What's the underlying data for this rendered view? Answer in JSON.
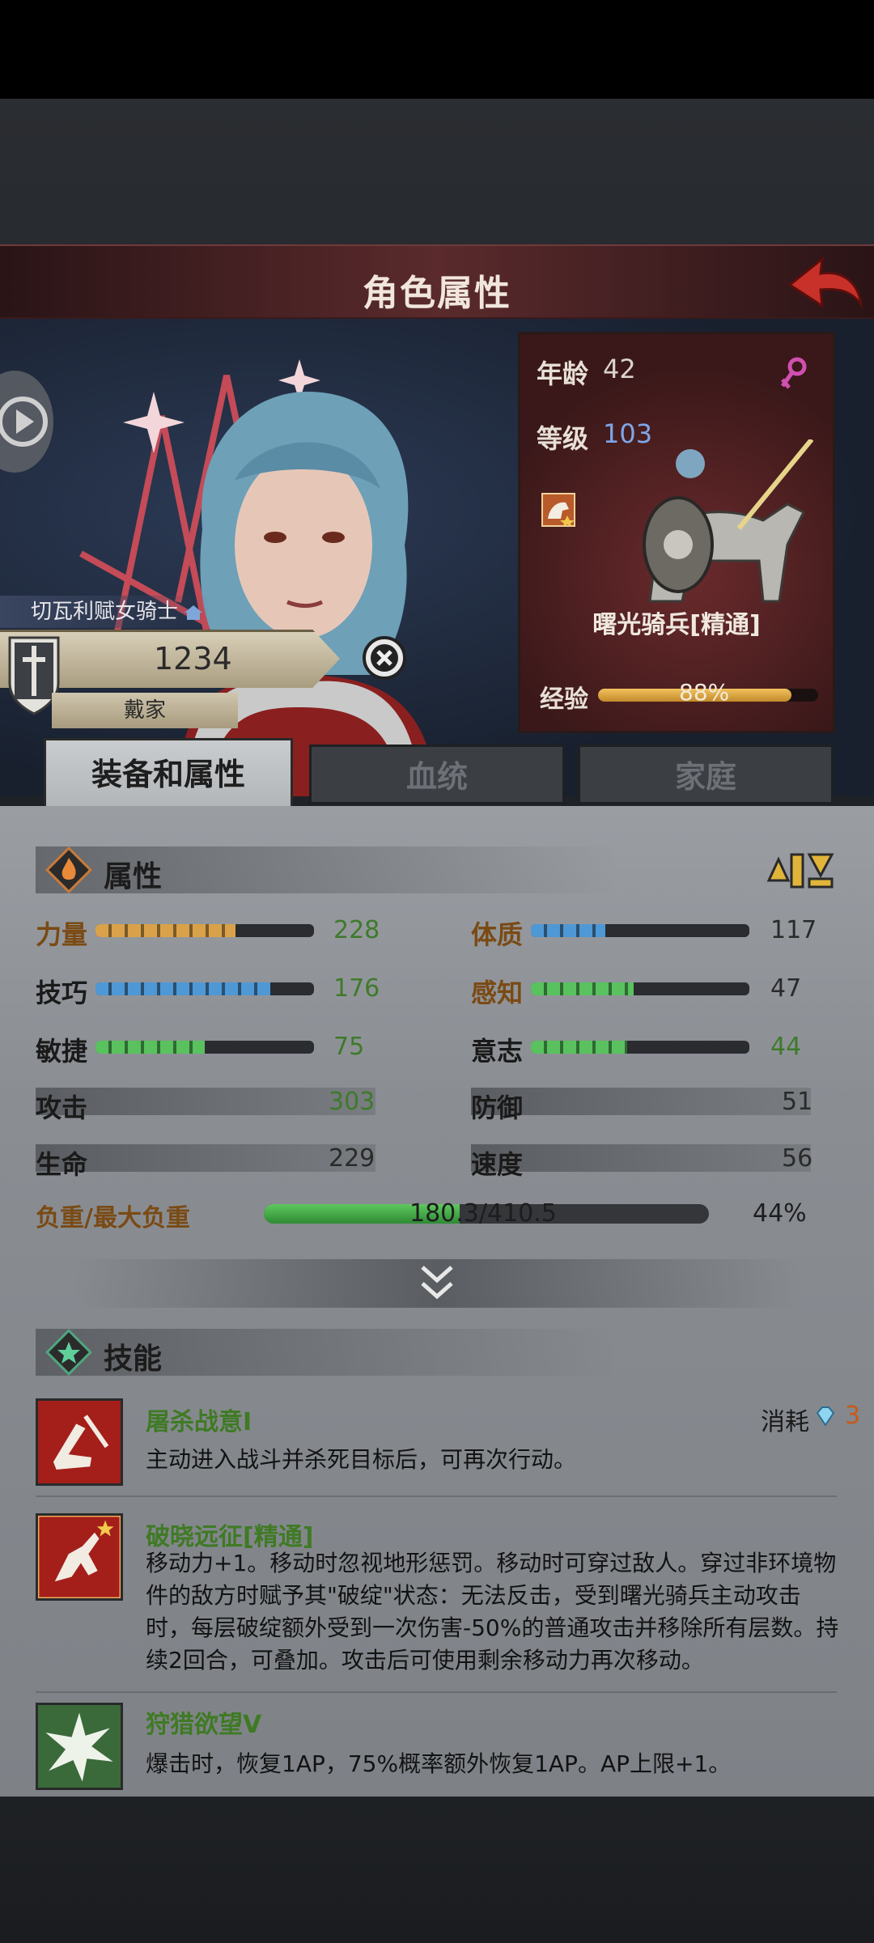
{
  "header": {
    "title": "角色属性"
  },
  "character": {
    "name": "切瓦利赋女骑士",
    "power": "1234",
    "family": "戴家"
  },
  "info": {
    "age_label": "年龄",
    "age": "42",
    "level_label": "等级",
    "level": "103",
    "unit_name": "曙光骑兵[精通]",
    "exp_label": "经验",
    "exp_text": "88%",
    "exp_fraction": 0.88
  },
  "tabs": [
    "装备和属性",
    "血统",
    "家庭"
  ],
  "attributes": {
    "title": "属性",
    "stats": [
      {
        "label": "力量",
        "value": "228",
        "fill": 0.64,
        "color": "orange"
      },
      {
        "label": "体质",
        "value": "117",
        "fill": 0.34,
        "color": "blue"
      },
      {
        "label": "技巧",
        "value": "176",
        "fill": 0.8,
        "color": "blue"
      },
      {
        "label": "感知",
        "value": "47",
        "fill": 0.47,
        "color": "green"
      },
      {
        "label": "敏捷",
        "value": "75",
        "fill": 0.5,
        "color": "green"
      },
      {
        "label": "意志",
        "value": "44",
        "fill": 0.44,
        "color": "green"
      }
    ],
    "derived": [
      {
        "label": "攻击",
        "value": "303"
      },
      {
        "label": "防御",
        "value": "51"
      },
      {
        "label": "生命",
        "value": "229"
      },
      {
        "label": "速度",
        "value": "56"
      }
    ],
    "load_label": "负重/最大负重",
    "load_text": "180.3/410.5",
    "load_pct": "44%",
    "load_fraction": 0.44
  },
  "skills": {
    "title": "技能",
    "cost_label": "消耗",
    "items": [
      {
        "name": "屠杀战意I",
        "desc": "主动进入战斗并杀死目标后，可再次行动。",
        "cost": "3"
      },
      {
        "name": "破晓远征[精通]",
        "desc": "移动力+1。移动时忽视地形惩罚。移动时可穿过敌人。穿过非环境物件的敌方时赋予其\"破绽\"状态：无法反击，受到曙光骑兵主动攻击时，每层破绽额外受到一次伤害-50%的普通攻击并移除所有层数。持续2回合，可叠加。攻击后可使用剩余移动力再次移动。"
      },
      {
        "name": "狩猎欲望V",
        "desc": "爆击时，恢复1AP，75%概率额外恢复1AP。AP上限+1。"
      }
    ]
  },
  "colors": {
    "accent_red": "#5a2a2c",
    "skill_green": "#3f7a24",
    "stat_gold": "#7a4a14"
  }
}
